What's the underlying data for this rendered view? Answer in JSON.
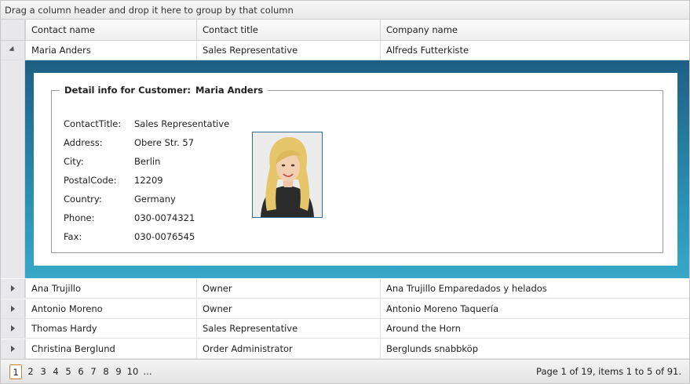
{
  "group_panel": {
    "text": "Drag a column header and drop it here to group by that column"
  },
  "columns": [
    "Contact name",
    "Contact title",
    "Company name"
  ],
  "expanded_row": {
    "contact_name": "Maria Anders",
    "contact_title": "Sales Representative",
    "company_name": "Alfreds Futterkiste"
  },
  "detail": {
    "legend_prefix": "Detail info for Customer:",
    "legend_name": "Maria Anders",
    "fields": [
      {
        "label": "ContactTitle:",
        "value": "Sales Representative"
      },
      {
        "label": "Address:",
        "value": "Obere Str. 57"
      },
      {
        "label": "City:",
        "value": "Berlin"
      },
      {
        "label": "PostalCode:",
        "value": "12209"
      },
      {
        "label": "Country:",
        "value": "Germany"
      },
      {
        "label": "Phone:",
        "value": "030-0074321"
      },
      {
        "label": "Fax:",
        "value": "030-0076545"
      }
    ]
  },
  "rows": [
    {
      "contact_name": "Ana Trujillo",
      "contact_title": "Owner",
      "company_name": "Ana Trujillo Emparedados y helados"
    },
    {
      "contact_name": "Antonio Moreno",
      "contact_title": "Owner",
      "company_name": "Antonio Moreno Taquería"
    },
    {
      "contact_name": "Thomas Hardy",
      "contact_title": "Sales Representative",
      "company_name": "Around the Horn"
    },
    {
      "contact_name": "Christina Berglund",
      "contact_title": "Order Administrator",
      "company_name": "Berglunds snabbköp"
    }
  ],
  "pager": {
    "pages": [
      "1",
      "2",
      "3",
      "4",
      "5",
      "6",
      "7",
      "8",
      "9",
      "10",
      "..."
    ],
    "current": "1",
    "info": "Page 1 of 19, items 1 to 5 of 91."
  },
  "colors": {
    "detail_gradient_top": "#1e5f84",
    "detail_gradient_bottom": "#38a8c8",
    "current_page_border": "#d2813a"
  }
}
